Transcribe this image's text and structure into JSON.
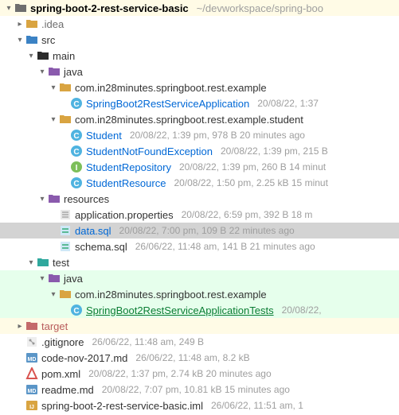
{
  "root": {
    "name": "spring-boot-2-rest-service-basic",
    "path": "~/devworkspace/spring-boo"
  },
  "idea": {
    "name": ".idea"
  },
  "src": {
    "name": "src"
  },
  "main": {
    "name": "main"
  },
  "java_main": {
    "name": "java"
  },
  "pkg_example": {
    "name": "com.in28minutes.springboot.rest.example"
  },
  "app_class": {
    "name": "SpringBoot2RestServiceApplication",
    "meta": "20/08/22, 1:37"
  },
  "pkg_student": {
    "name": "com.in28minutes.springboot.rest.example.student"
  },
  "student": {
    "name": "Student",
    "meta": "20/08/22, 1:39 pm, 978 B 20 minutes ago"
  },
  "student_nfe": {
    "name": "StudentNotFoundException",
    "meta": "20/08/22, 1:39 pm, 215 B"
  },
  "student_repo": {
    "name": "StudentRepository",
    "meta": "20/08/22, 1:39 pm, 260 B 14 minut"
  },
  "student_res": {
    "name": "StudentResource",
    "meta": "20/08/22, 1:50 pm, 2.25 kB 15 minut"
  },
  "resources": {
    "name": "resources"
  },
  "app_props": {
    "name": "application.properties",
    "meta": "20/08/22, 6:59 pm, 392 B 18 m"
  },
  "data_sql": {
    "name": "data.sql",
    "meta": "20/08/22, 7:00 pm, 109 B 22 minutes ago"
  },
  "schema_sql": {
    "name": "schema.sql",
    "meta": "26/06/22, 11:48 am, 141 B 21 minutes ago"
  },
  "test": {
    "name": "test"
  },
  "java_test": {
    "name": "java"
  },
  "pkg_test": {
    "name": "com.in28minutes.springboot.rest.example"
  },
  "app_tests": {
    "name": "SpringBoot2RestServiceApplicationTests",
    "meta": "20/08/22,"
  },
  "target": {
    "name": "target"
  },
  "gitignore": {
    "name": ".gitignore",
    "meta": "26/06/22, 11:48 am, 249 B"
  },
  "code_md": {
    "name": "code-nov-2017.md",
    "meta": "26/06/22, 11:48 am, 8.2 kB"
  },
  "pom": {
    "name": "pom.xml",
    "meta": "20/08/22, 1:37 pm, 2.74 kB 20 minutes ago"
  },
  "readme": {
    "name": "readme.md",
    "meta": "20/08/22, 7:07 pm, 10.81 kB 15 minutes ago"
  },
  "iml": {
    "name": "spring-boot-2-rest-service-basic.iml",
    "meta": "26/06/22, 11:51 am, 1"
  }
}
